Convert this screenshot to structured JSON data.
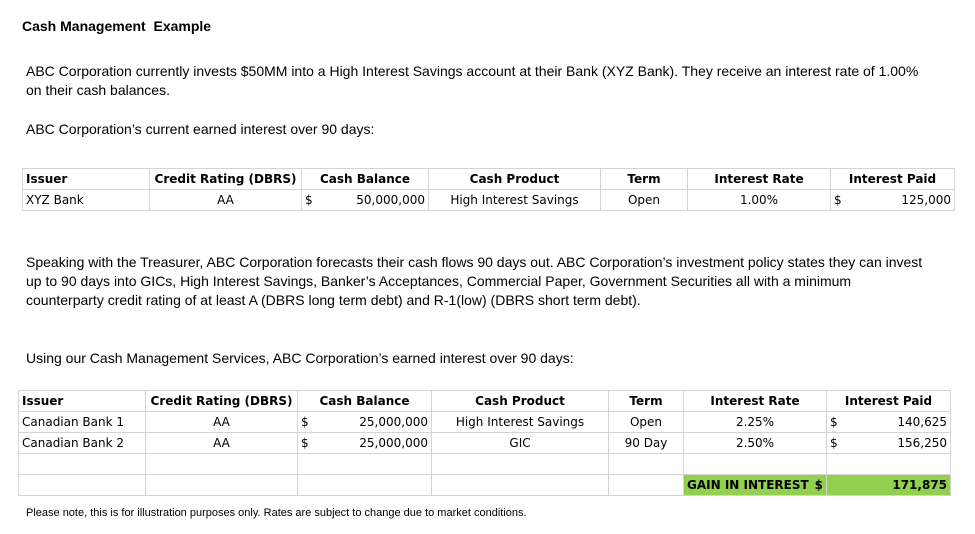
{
  "title": "Cash Management  Example",
  "intro": "ABC Corporation currently invests $50MM into a High Interest Savings account at their Bank (XYZ Bank). They receive an interest rate of 1.00% on their cash balances.",
  "current_label": "ABC Corporation’s current earned interest over 90 days:",
  "headers": {
    "issuer": "Issuer",
    "rating": "Credit Rating (DBRS)",
    "balance": "Cash Balance",
    "product": "Cash Product",
    "term": "Term",
    "rate": "Interest Rate",
    "paid": "Interest Paid"
  },
  "current_rows": [
    {
      "issuer": "XYZ Bank",
      "rating": "AA",
      "currency": "$",
      "balance": "50,000,000",
      "product": "High Interest Savings",
      "term": "Open",
      "rate": "1.00%",
      "paid_currency": "$",
      "paid": "125,000"
    }
  ],
  "forecast_text": "Speaking with the Treasurer, ABC Corporation forecasts their cash flows 90 days out. ABC Corporation’s investment policy states they can invest up to 90 days into GICs, High Interest Savings, Banker’s Acceptances, Commercial Paper, Government Securities all with a minimum counterparty credit rating of at least A (DBRS long term debt) and R-1(low) (DBRS short term debt).",
  "services_label": "Using our Cash Management  Services, ABC Corporation’s earned interest over 90 days:",
  "proposed_rows": [
    {
      "issuer": "Canadian Bank 1",
      "rating": "AA",
      "currency": "$",
      "balance": "25,000,000",
      "product": "High Interest Savings",
      "term": "Open",
      "rate": "2.25%",
      "paid_currency": "$",
      "paid": "140,625"
    },
    {
      "issuer": "Canadian Bank 2",
      "rating": "AA",
      "currency": "$",
      "balance": "25,000,000",
      "product": "GIC",
      "term": "90 Day",
      "rate": "2.50%",
      "paid_currency": "$",
      "paid": "156,250"
    }
  ],
  "gain": {
    "label": "GAIN IN INTEREST",
    "currency": "$",
    "value": "171,875",
    "color": "#92d050"
  },
  "note": "Please note, this is for illustration purposes only.  Rates are subject to change due to market conditions."
}
